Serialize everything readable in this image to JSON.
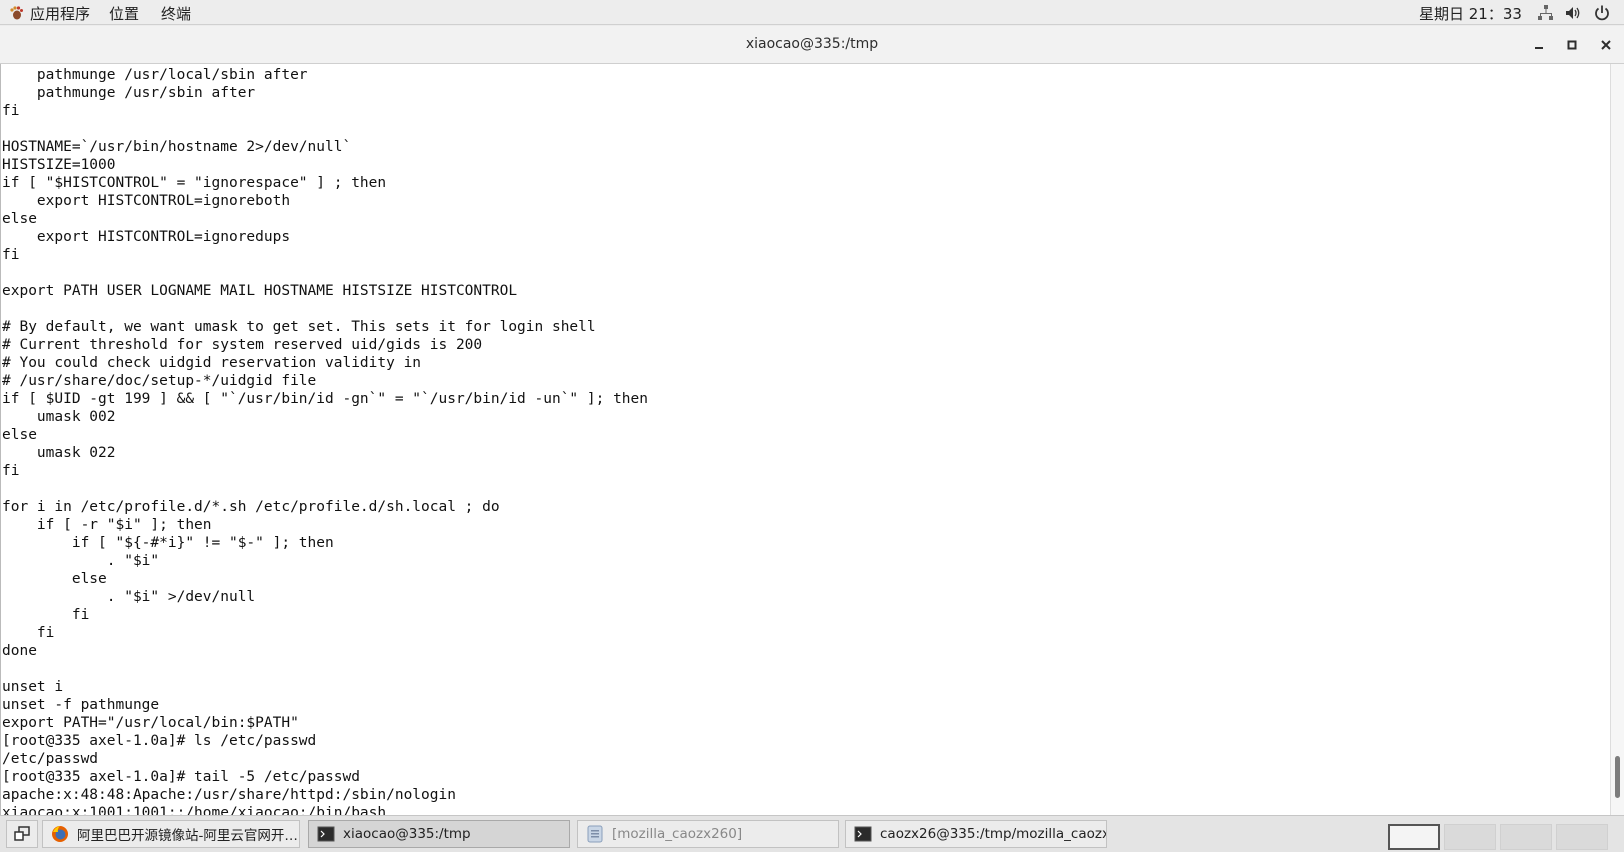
{
  "top_panel": {
    "apps": "应用程序",
    "places": "位置",
    "terminal": "终端",
    "clock": "星期日 21：33"
  },
  "window": {
    "title": "xiaocao@335:/tmp"
  },
  "terminal": {
    "lines": [
      "    pathmunge /usr/local/sbin after",
      "    pathmunge /usr/sbin after",
      "fi",
      "",
      "HOSTNAME=`/usr/bin/hostname 2>/dev/null`",
      "HISTSIZE=1000",
      "if [ \"$HISTCONTROL\" = \"ignorespace\" ] ; then",
      "    export HISTCONTROL=ignoreboth",
      "else",
      "    export HISTCONTROL=ignoredups",
      "fi",
      "",
      "export PATH USER LOGNAME MAIL HOSTNAME HISTSIZE HISTCONTROL",
      "",
      "# By default, we want umask to get set. This sets it for login shell",
      "# Current threshold for system reserved uid/gids is 200",
      "# You could check uidgid reservation validity in",
      "# /usr/share/doc/setup-*/uidgid file",
      "if [ $UID -gt 199 ] && [ \"`/usr/bin/id -gn`\" = \"`/usr/bin/id -un`\" ]; then",
      "    umask 002",
      "else",
      "    umask 022",
      "fi",
      "",
      "for i in /etc/profile.d/*.sh /etc/profile.d/sh.local ; do",
      "    if [ -r \"$i\" ]; then",
      "        if [ \"${-#*i}\" != \"$-\" ]; then",
      "            . \"$i\"",
      "        else",
      "            . \"$i\" >/dev/null",
      "        fi",
      "    fi",
      "done",
      "",
      "unset i",
      "unset -f pathmunge",
      "export PATH=\"/usr/local/bin:$PATH\"",
      "[root@335 axel-1.0a]# ls /etc/passwd",
      "/etc/passwd",
      "[root@335 axel-1.0a]# tail -5 /etc/passwd",
      "apache:x:48:48:Apache:/usr/share/httpd:/sbin/nologin",
      "xiaocao:x:1001:1001::/home/xiaocao:/bin/bash"
    ]
  },
  "taskbar": {
    "tasks": [
      {
        "label": "阿里巴巴开源镜像站-阿里云官网开…",
        "icon": "firefox-icon"
      },
      {
        "label": "xiaocao@335:/tmp",
        "icon": "terminal-icon"
      },
      {
        "label": "[mozilla_caozx260]",
        "icon": "file-manager-icon"
      },
      {
        "label": "caozx26@335:/tmp/mozilla_caozx…",
        "icon": "terminal-icon"
      }
    ]
  },
  "colors": {
    "panel_bg": "#ededed",
    "terminal_bg": "#ffffff",
    "terminal_fg": "#111111",
    "taskbar_bg": "#e4e4e4"
  }
}
